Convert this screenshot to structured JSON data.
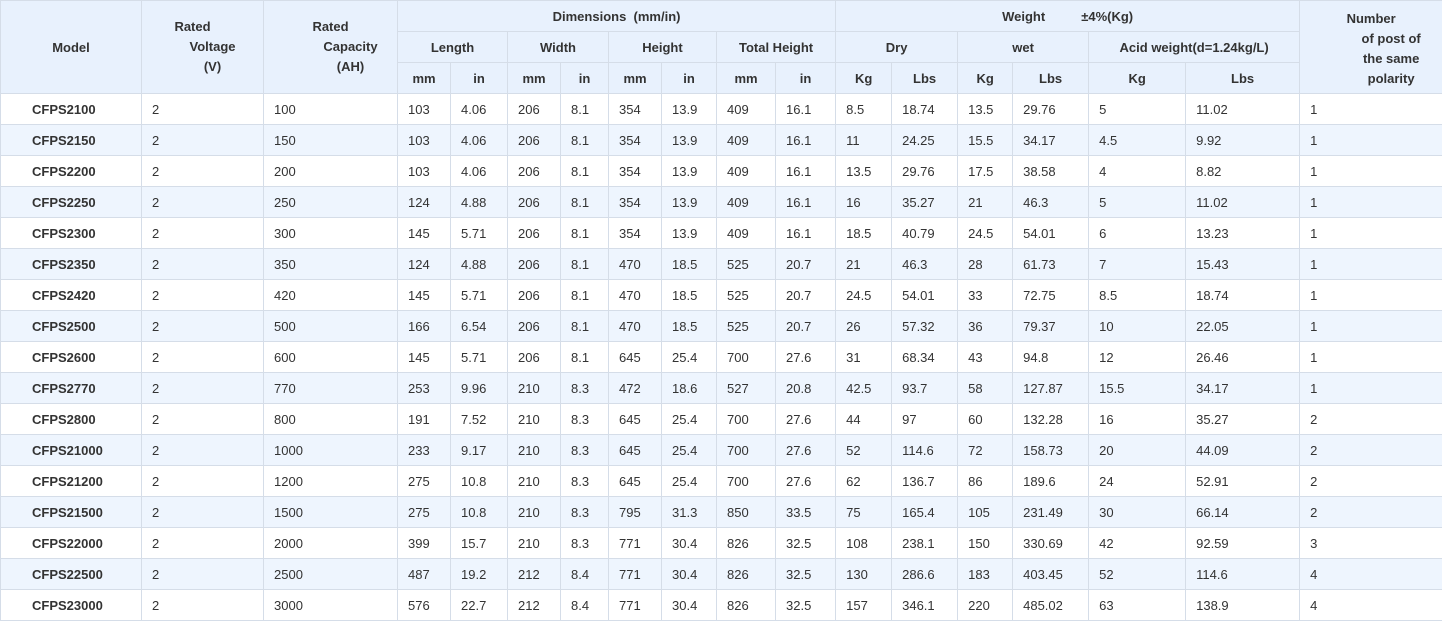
{
  "headers": {
    "model": "Model",
    "voltage": [
      "Rated",
      "Voltage",
      "(V)"
    ],
    "capacity": [
      "Rated",
      "Capacity",
      "(AH)"
    ],
    "dimensions": "Dimensions  (mm/in)",
    "weight": "Weight",
    "weight_tol": "±4%(Kg)",
    "posts": [
      "Number",
      "of post of",
      "the same",
      "polarity"
    ],
    "length": "Length",
    "width": "Width",
    "height": "Height",
    "total_height": "Total Height",
    "dry": "Dry",
    "wet": "wet",
    "acid": "Acid weight(d=1.24kg/L)",
    "units": [
      "mm",
      "in",
      "mm",
      "in",
      "mm",
      "in",
      "mm",
      "in",
      "Kg",
      "Lbs",
      "Kg",
      "Lbs",
      "Kg",
      "Lbs"
    ]
  },
  "rows": [
    [
      "CFPS2100",
      "2",
      "100",
      "103",
      "4.06",
      "206",
      "8.1",
      "354",
      "13.9",
      "409",
      "16.1",
      "8.5",
      "18.74",
      "13.5",
      "29.76",
      "5",
      "11.02",
      "1"
    ],
    [
      "CFPS2150",
      "2",
      "150",
      "103",
      "4.06",
      "206",
      "8.1",
      "354",
      "13.9",
      "409",
      "16.1",
      "11",
      "24.25",
      "15.5",
      "34.17",
      "4.5",
      "9.92",
      "1"
    ],
    [
      "CFPS2200",
      "2",
      "200",
      "103",
      "4.06",
      "206",
      "8.1",
      "354",
      "13.9",
      "409",
      "16.1",
      "13.5",
      "29.76",
      "17.5",
      "38.58",
      "4",
      "8.82",
      "1"
    ],
    [
      "CFPS2250",
      "2",
      "250",
      "124",
      "4.88",
      "206",
      "8.1",
      "354",
      "13.9",
      "409",
      "16.1",
      "16",
      "35.27",
      "21",
      "46.3",
      "5",
      "11.02",
      "1"
    ],
    [
      "CFPS2300",
      "2",
      "300",
      "145",
      "5.71",
      "206",
      "8.1",
      "354",
      "13.9",
      "409",
      "16.1",
      "18.5",
      "40.79",
      "24.5",
      "54.01",
      "6",
      "13.23",
      "1"
    ],
    [
      "CFPS2350",
      "2",
      "350",
      "124",
      "4.88",
      "206",
      "8.1",
      "470",
      "18.5",
      "525",
      "20.7",
      "21",
      "46.3",
      "28",
      "61.73",
      "7",
      "15.43",
      "1"
    ],
    [
      "CFPS2420",
      "2",
      "420",
      "145",
      "5.71",
      "206",
      "8.1",
      "470",
      "18.5",
      "525",
      "20.7",
      "24.5",
      "54.01",
      "33",
      "72.75",
      "8.5",
      "18.74",
      "1"
    ],
    [
      "CFPS2500",
      "2",
      "500",
      "166",
      "6.54",
      "206",
      "8.1",
      "470",
      "18.5",
      "525",
      "20.7",
      "26",
      "57.32",
      "36",
      "79.37",
      "10",
      "22.05",
      "1"
    ],
    [
      "CFPS2600",
      "2",
      "600",
      "145",
      "5.71",
      "206",
      "8.1",
      "645",
      "25.4",
      "700",
      "27.6",
      "31",
      "68.34",
      "43",
      "94.8",
      "12",
      "26.46",
      "1"
    ],
    [
      "CFPS2770",
      "2",
      "770",
      "253",
      "9.96",
      "210",
      "8.3",
      "472",
      "18.6",
      "527",
      "20.8",
      "42.5",
      "93.7",
      "58",
      "127.87",
      "15.5",
      "34.17",
      "1"
    ],
    [
      "CFPS2800",
      "2",
      "800",
      "191",
      "7.52",
      "210",
      "8.3",
      "645",
      "25.4",
      "700",
      "27.6",
      "44",
      "97",
      "60",
      "132.28",
      "16",
      "35.27",
      "2"
    ],
    [
      "CFPS21000",
      "2",
      "1000",
      "233",
      "9.17",
      "210",
      "8.3",
      "645",
      "25.4",
      "700",
      "27.6",
      "52",
      "114.6",
      "72",
      "158.73",
      "20",
      "44.09",
      "2"
    ],
    [
      "CFPS21200",
      "2",
      "1200",
      "275",
      "10.8",
      "210",
      "8.3",
      "645",
      "25.4",
      "700",
      "27.6",
      "62",
      "136.7",
      "86",
      "189.6",
      "24",
      "52.91",
      "2"
    ],
    [
      "CFPS21500",
      "2",
      "1500",
      "275",
      "10.8",
      "210",
      "8.3",
      "795",
      "31.3",
      "850",
      "33.5",
      "75",
      "165.4",
      "105",
      "231.49",
      "30",
      "66.14",
      "2"
    ],
    [
      "CFPS22000",
      "2",
      "2000",
      "399",
      "15.7",
      "210",
      "8.3",
      "771",
      "30.4",
      "826",
      "32.5",
      "108",
      "238.1",
      "150",
      "330.69",
      "42",
      "92.59",
      "3"
    ],
    [
      "CFPS22500",
      "2",
      "2500",
      "487",
      "19.2",
      "212",
      "8.4",
      "771",
      "30.4",
      "826",
      "32.5",
      "130",
      "286.6",
      "183",
      "403.45",
      "52",
      "114.6",
      "4"
    ],
    [
      "CFPS23000",
      "2",
      "3000",
      "576",
      "22.7",
      "212",
      "8.4",
      "771",
      "30.4",
      "826",
      "32.5",
      "157",
      "346.1",
      "220",
      "485.02",
      "63",
      "138.9",
      "4"
    ]
  ]
}
